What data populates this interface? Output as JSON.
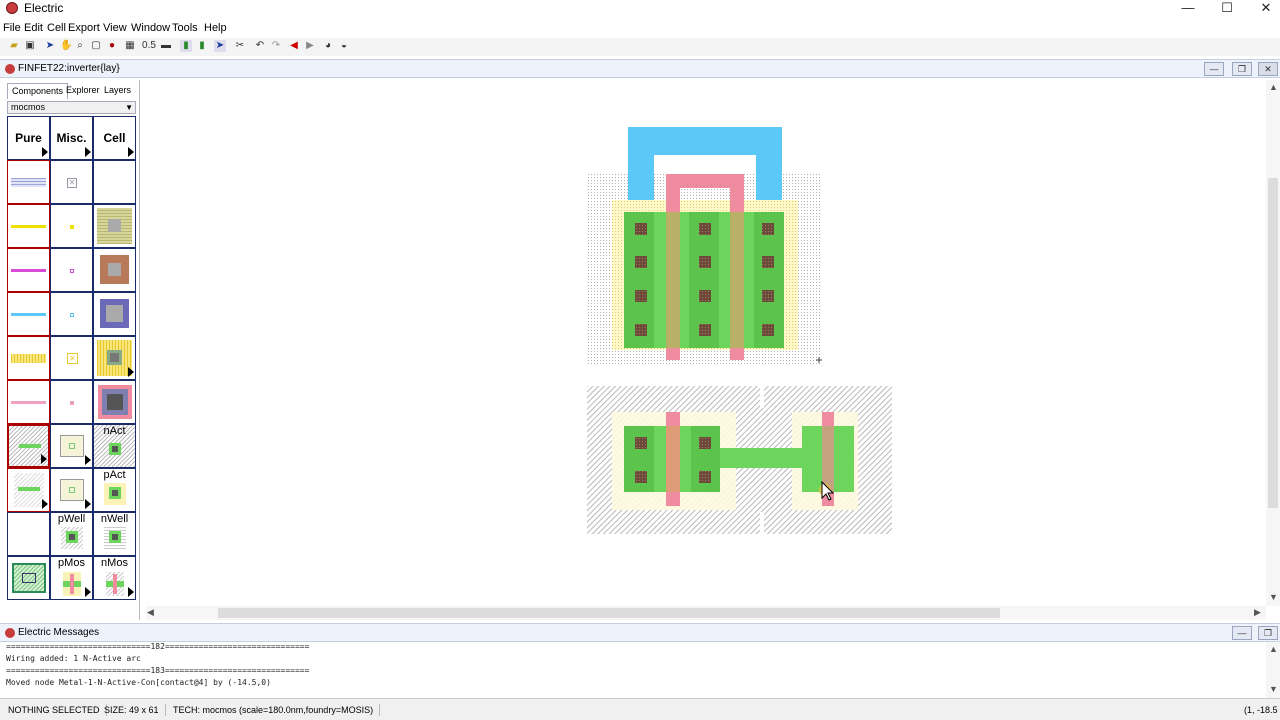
{
  "window": {
    "title": "Electric",
    "minimize": "—",
    "maximize": "☐",
    "close": "✕"
  },
  "menu": [
    "File",
    "Edit",
    "Cell",
    "Export",
    "View",
    "Window",
    "Tools",
    "Help"
  ],
  "toolbar": {
    "scale": "0.5"
  },
  "document": {
    "title": "FINFET22:inverter{lay}",
    "minimize": "—",
    "restore": "❐",
    "close": "✕"
  },
  "left_panel": {
    "tabs": [
      "Components",
      "Explorer",
      "Layers"
    ],
    "technology": "mocmos",
    "headers": [
      "Pure",
      "Misc.",
      "Cell"
    ],
    "labels": {
      "nact": "nAct",
      "pact": "pAct",
      "pwell": "pWell",
      "nwell": "nWell",
      "pmos": "pMos",
      "nmos": "nMos"
    }
  },
  "colors": {
    "metal1": "#5cc8f8",
    "poly": "#f08ca0",
    "active": "#6cd65c",
    "contact": "#6e4a3a",
    "select": "#fff4a8",
    "well": "#9a9a9a"
  },
  "messages": {
    "title": "Electric Messages",
    "lines": [
      "==============================182==============================",
      "Wiring added: 1 N-Active arc",
      "==============================183==============================",
      "Moved node Metal-1-N-Active-Con[contact@4] by (-14.5,0)"
    ]
  },
  "status": {
    "selection": "NOTHING SELECTED",
    "size": "SIZE: 49 x 61",
    "tech": "TECH: mocmos (scale=180.0nm,foundry=MOSIS)",
    "coords": "(1, -18.5"
  }
}
